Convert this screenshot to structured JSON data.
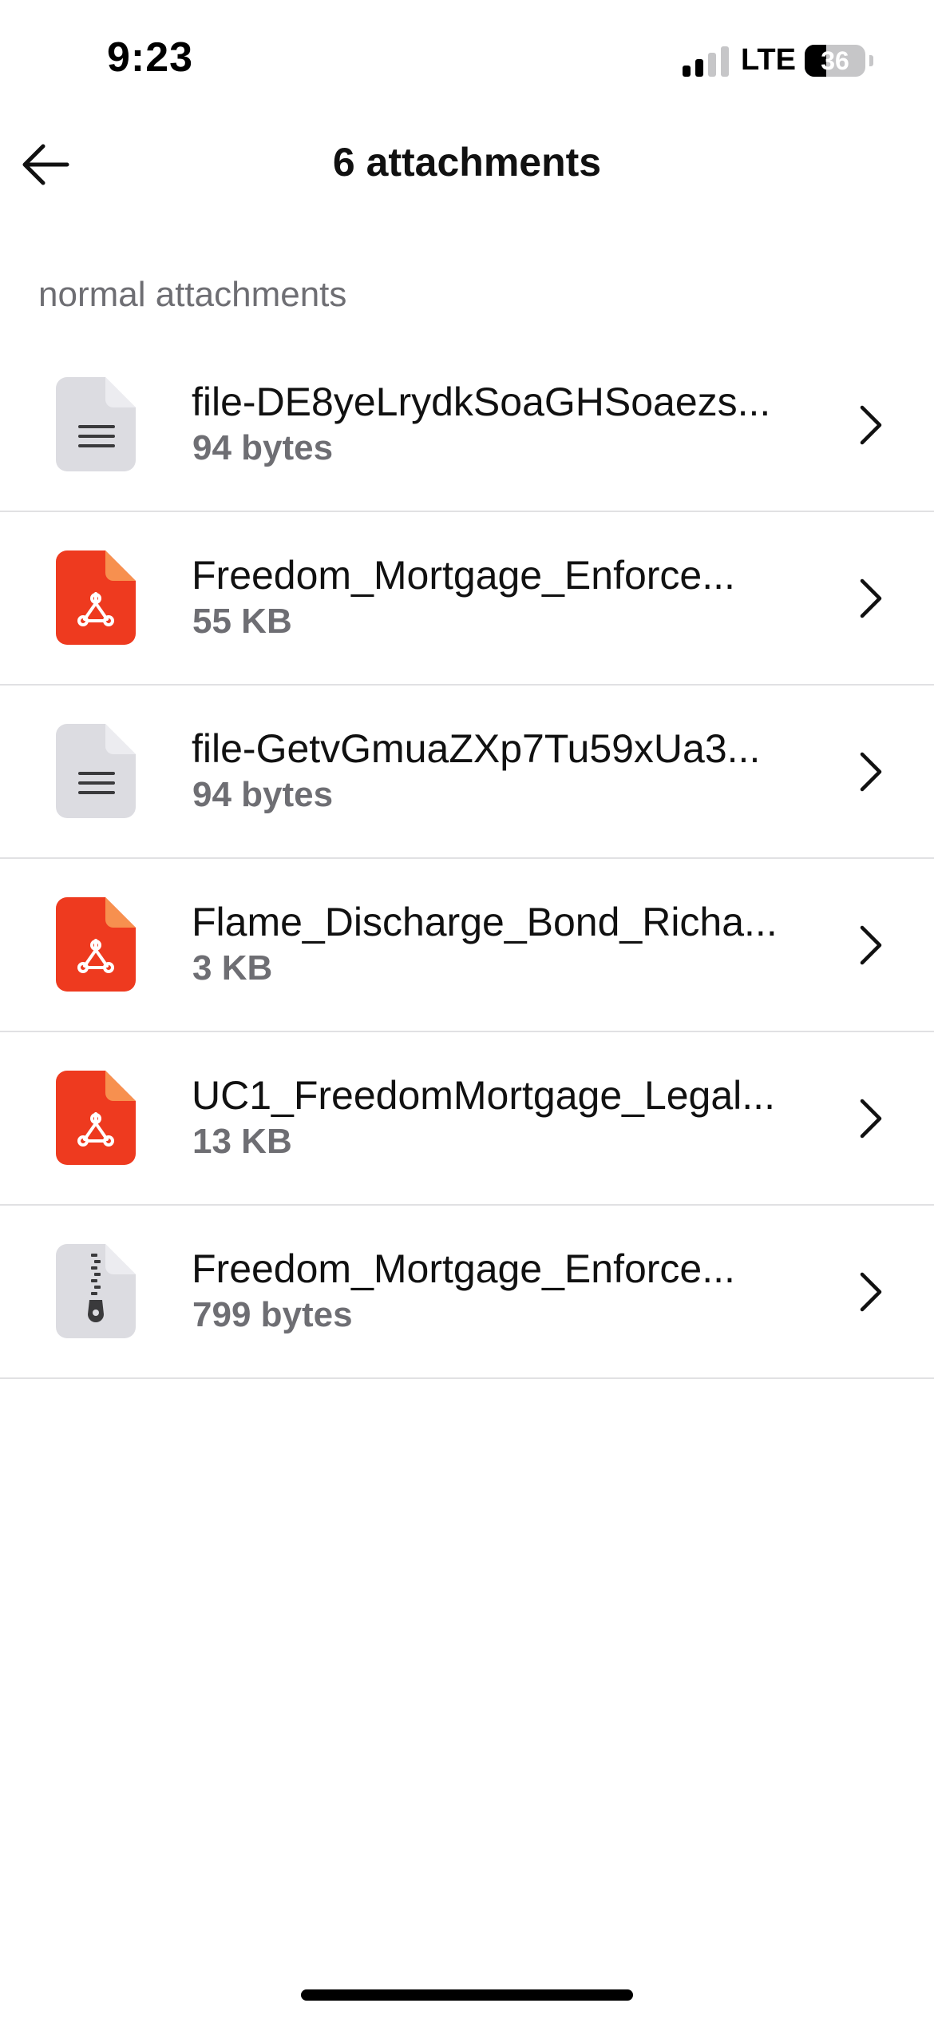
{
  "status_bar": {
    "time": "9:23",
    "network": "LTE",
    "battery_percent": "36",
    "battery_level": 0.36,
    "signal_bars_active": 2,
    "signal_bars_total": 4
  },
  "header": {
    "title": "6 attachments",
    "back_icon": "arrow-left-icon"
  },
  "section": {
    "label": "normal attachments"
  },
  "attachments": [
    {
      "name": "file-DE8yeLrydkSoaGHSoaezs...",
      "size": "94 bytes",
      "icon": "text-document-icon"
    },
    {
      "name": "Freedom_Mortgage_Enforce...",
      "size": "55 KB",
      "icon": "pdf-file-icon"
    },
    {
      "name": "file-GetvGmuaZXp7Tu59xUa3...",
      "size": "94 bytes",
      "icon": "text-document-icon"
    },
    {
      "name": "Flame_Discharge_Bond_Richa...",
      "size": "3 KB",
      "icon": "pdf-file-icon"
    },
    {
      "name": "UC1_FreedomMortgage_Legal...",
      "size": "13 KB",
      "icon": "pdf-file-icon"
    },
    {
      "name": "Freedom_Mortgage_Enforce...",
      "size": "799 bytes",
      "icon": "zip-archive-icon"
    }
  ],
  "colors": {
    "pdf_red": "#ee3a1f",
    "pdf_fold": "#f7904f",
    "doc_gray": "#dcdce1",
    "doc_fold": "#ececf0",
    "secondary_text": "#6e6e73",
    "divider": "#e1e1e3"
  }
}
